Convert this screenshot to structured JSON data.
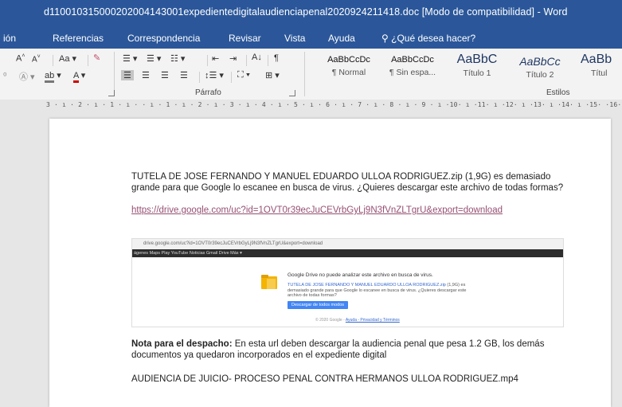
{
  "window": {
    "title": "d110010315000202004143001expedientedigitalaudienciapenal2020924211418.doc [Modo de compatibilidad] - Word"
  },
  "tabs": [
    "ión",
    "Referencias",
    "Correspondencia",
    "Revisar",
    "Vista",
    "Ayuda",
    "¿Qué desea hacer?"
  ],
  "ribbon": {
    "font_row1": [
      "A",
      "A",
      "Aa"
    ],
    "font_group_label": "",
    "paragraph_group_label": "Párrafo",
    "styles_group_label": "Estilos",
    "styles": [
      {
        "sample": "AaBbCcDc",
        "name": "¶ Normal"
      },
      {
        "sample": "AaBbCcDc",
        "name": "¶ Sin espa..."
      },
      {
        "sample": "AaBbC",
        "name": "Título 1"
      },
      {
        "sample": "AaBbCc",
        "name": "Título 2"
      },
      {
        "sample": "AaBb",
        "name": "Títul"
      }
    ]
  },
  "ruler": {
    "text": "3 · ı · 2 · ı · 1 · ı ·   · ı · 1 · ı · 2 · ı · 3 · ı · 4 · ı · 5 · ı · 6 · ı · 7 · ı · 8 · ı · 9 · ı ·10· ı ·11· ı ·12· ı ·13· ı ·14· ı ·15·  ·16· ı ·17·"
  },
  "document": {
    "para1": "TUTELA DE JOSE FERNANDO Y MANUEL EDUARDO ULLOA RODRIGUEZ.zip (1,9G) es demasiado grande para que Google lo escanee en busca de virus. ¿Quieres descargar este archivo de todas formas?",
    "link": "https://drive.google.com/uc?id=1OVT0r39ecJuCEVrbGyLj9N3fVnZLTgrU&export=download",
    "screenshot": {
      "address": "drive.google.com/uc?id=1OVT0r39ecJuCEVrbGyLj9N3fVnZLTgrU&export=download",
      "gbar": "ágenes  Maps  Play  YouTube  Noticias  Gmail  Drive  Más ▾",
      "heading": "Google Drive no puede analizar este archivo en busca de virus.",
      "file_name": "TUTELA DE JOSE FERNANDO Y MANUEL EDUARDO ULLOA RODRIGUEZ.zip",
      "body": "(1,9G) es demasiado grande para que Google lo escanee en busca de virus. ¿Quieres descargar este archivo de todas formas?",
      "button": "Descargar de todos modos",
      "footer": "© 2020 Google - ",
      "footer_links": "Ayuda - Privacidad y Términos"
    },
    "note_bold": "Nota para el despacho:",
    "note_text": " En esta url deben descargar la audiencia penal que pesa 1.2 GB, los demás documentos ya quedaron incorporados en el expediente digital",
    "last_line": "AUDIENCIA DE JUICIO- PROCESO PENAL CONTRA HERMANOS ULLOA RODRIGUEZ.mp4"
  },
  "colors": {
    "title_bar": "#2b579a",
    "link": "#954f72",
    "drive_button": "#4285f4"
  }
}
